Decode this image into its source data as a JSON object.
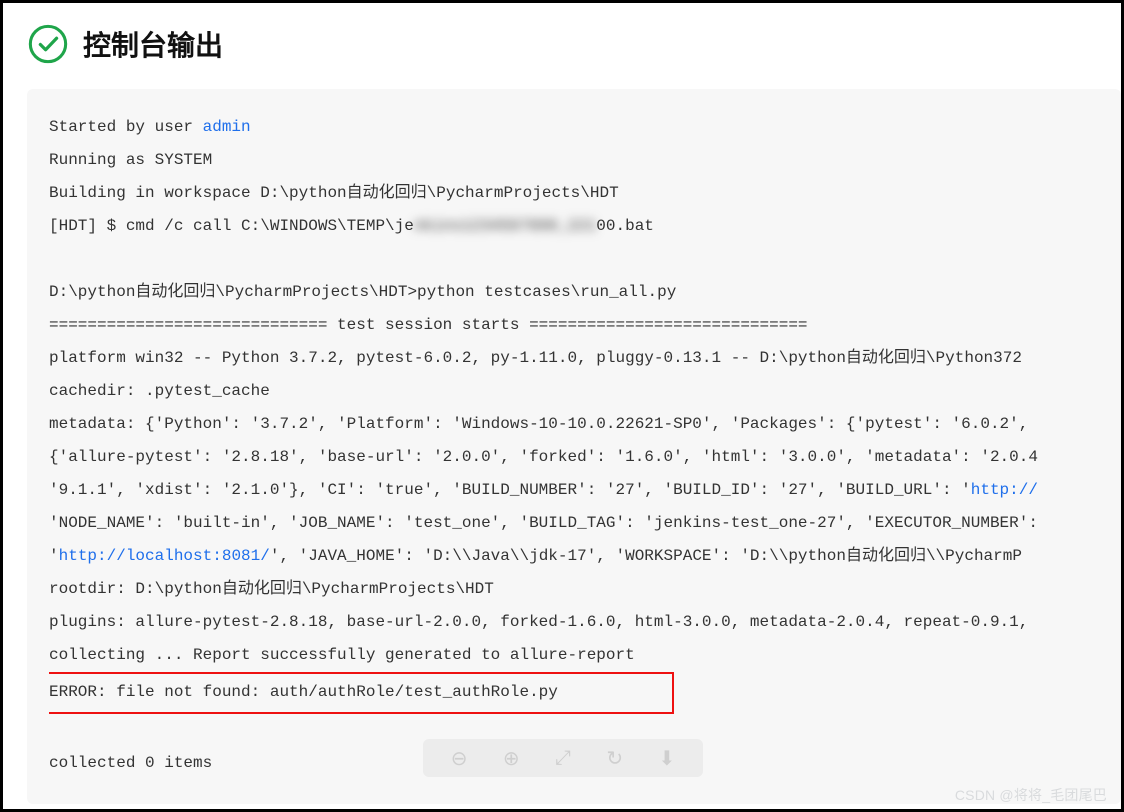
{
  "header": {
    "title": "控制台输出",
    "status_icon": "success-check-icon"
  },
  "console": {
    "line_started_prefix": "Started by user ",
    "user_link": "admin",
    "line_running": "Running as SYSTEM",
    "line_building": "Building in workspace D:\\python自动化回归\\PycharmProjects\\HDT",
    "line_cmd_prefix": "[HDT] $ cmd /c call C:\\WINDOWS\\TEMP\\je",
    "line_cmd_blur": "nkins1234567890_221",
    "line_cmd_suffix": "00.bat",
    "line_run": "D:\\python自动化回归\\PycharmProjects\\HDT>python testcases\\run_all.py",
    "line_session": "============================= test session starts =============================",
    "line_platform": "platform win32 -- Python 3.7.2, pytest-6.0.2, py-1.11.0, pluggy-0.13.1 -- D:\\python自动化回归\\Python372",
    "line_cachedir": "cachedir: .pytest_cache",
    "line_metadata1": "metadata: {'Python': '3.7.2', 'Platform': 'Windows-10-10.0.22621-SP0', 'Packages': {'pytest': '6.0.2', ",
    "line_metadata2": "{'allure-pytest': '2.8.18', 'base-url': '2.0.0', 'forked': '1.6.0', 'html': '3.0.0', 'metadata': '2.0.4",
    "line_metadata3_prefix": "'9.1.1', 'xdist': '2.1.0'}, 'CI': 'true', 'BUILD_NUMBER': '27', 'BUILD_ID': '27', 'BUILD_URL': '",
    "line_metadata3_link": "http://",
    "line_metadata4": "'NODE_NAME': 'built-in', 'JOB_NAME': 'test_one', 'BUILD_TAG': 'jenkins-test_one-27', 'EXECUTOR_NUMBER':",
    "line_metadata5_prefix": "'",
    "line_metadata5_link": "http://localhost:8081/",
    "line_metadata5_suffix": "', 'JAVA_HOME': 'D:\\\\Java\\\\jdk-17', 'WORKSPACE': 'D:\\\\python自动化回归\\\\PycharmP",
    "line_rootdir": "rootdir: D:\\python自动化回归\\PycharmProjects\\HDT",
    "line_plugins": "plugins: allure-pytest-2.8.18, base-url-2.0.0, forked-1.6.0, html-3.0.0, metadata-2.0.4, repeat-0.9.1, ",
    "line_collecting": "collecting ... Report successfully generated to allure-report",
    "line_error": "ERROR: file not found: auth/authRole/test_authRole.py           ",
    "line_collected": "collected 0 items"
  },
  "watermark": "CSDN @将将_毛团尾巴"
}
